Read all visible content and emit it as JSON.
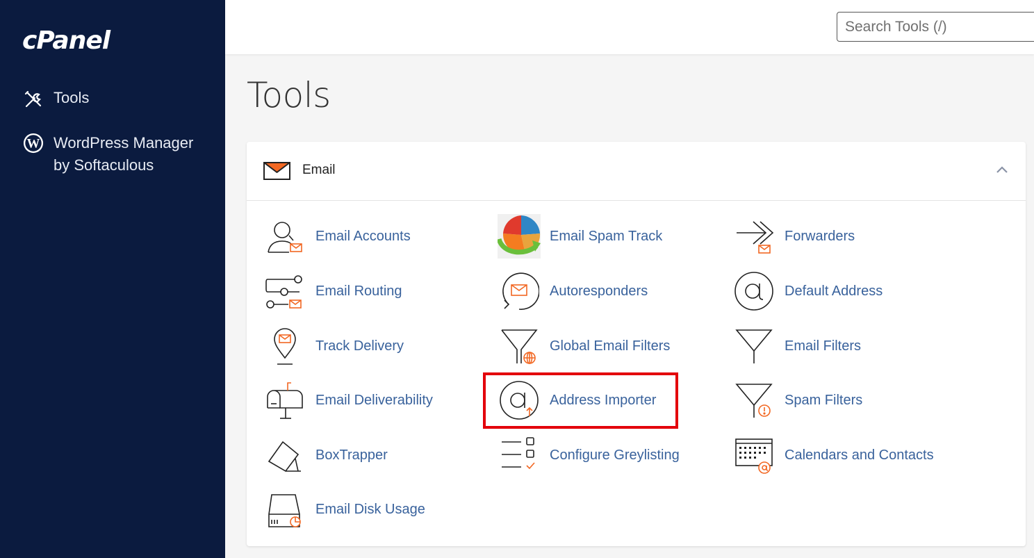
{
  "brand": {
    "logo_text": "cPanel"
  },
  "sidebar": {
    "items": [
      {
        "label": "Tools",
        "icon": "tools-icon"
      },
      {
        "label": "WordPress Manager by Softaculous",
        "icon": "wordpress-icon"
      }
    ]
  },
  "search": {
    "placeholder": "Search Tools (/)"
  },
  "page": {
    "title": "Tools"
  },
  "section": {
    "title": "Email",
    "icon": "envelope-icon",
    "collapse_icon": "chevron-up-icon"
  },
  "tools": [
    {
      "label": "Email Accounts",
      "icon": "user-email-icon"
    },
    {
      "label": "Email Spam Track",
      "icon": "pie-chart-arrow-icon"
    },
    {
      "label": "Forwarders",
      "icon": "forward-arrow-icon"
    },
    {
      "label": "Email Routing",
      "icon": "routing-icon"
    },
    {
      "label": "Autoresponders",
      "icon": "autoresponder-icon"
    },
    {
      "label": "Default Address",
      "icon": "at-sign-icon"
    },
    {
      "label": "Track Delivery",
      "icon": "location-pin-icon"
    },
    {
      "label": "Global Email Filters",
      "icon": "filter-globe-icon"
    },
    {
      "label": "Email Filters",
      "icon": "filter-icon"
    },
    {
      "label": "Email Deliverability",
      "icon": "mailbox-icon"
    },
    {
      "label": "Address Importer",
      "icon": "at-upload-icon"
    },
    {
      "label": "Spam Filters",
      "icon": "filter-warning-icon"
    },
    {
      "label": "BoxTrapper",
      "icon": "boxtrapper-icon"
    },
    {
      "label": "Configure Greylisting",
      "icon": "checklist-icon"
    },
    {
      "label": "Calendars and Contacts",
      "icon": "calendar-icon"
    },
    {
      "label": "Email Disk Usage",
      "icon": "disk-usage-icon"
    }
  ],
  "highlight_color": "#e3000b",
  "colors": {
    "sidebar": "#0b1b3f",
    "link": "#39629c",
    "accent": "#f26722"
  }
}
